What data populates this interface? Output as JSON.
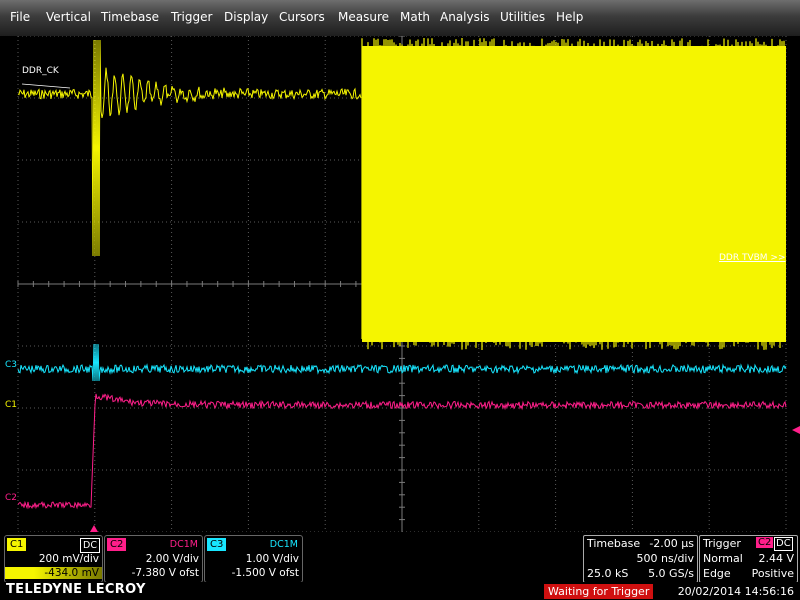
{
  "menu": [
    "File",
    "Vertical",
    "Timebase",
    "Trigger",
    "Display",
    "Cursors",
    "Measure",
    "Math",
    "Analysis",
    "Utilities",
    "Help"
  ],
  "colors": {
    "c1": "#f5f500",
    "c2": "#ff1f8a",
    "c3": "#18e6ff",
    "grid": "#5a5a5a",
    "trigger_marker": "#ff1f8a"
  },
  "grid": {
    "h_divisions": 10,
    "v_divisions": 8
  },
  "traces": {
    "c1": {
      "label": "C1",
      "annotation": "DDR_CK"
    },
    "c2": {
      "label": "C2"
    },
    "c3": {
      "label": "C3"
    },
    "right_annotation": "DDR TVBM >>"
  },
  "channels": [
    {
      "name": "C1",
      "coupling": "DC",
      "scale": "200 mV/div",
      "offset": "-434.0 mV"
    },
    {
      "name": "C2",
      "coupling": "DC1M",
      "scale": "2.00 V/div",
      "offset": "-7.380 V ofst"
    },
    {
      "name": "C3",
      "coupling": "DC1M",
      "scale": "1.00 V/div",
      "offset": "-1.500 V ofst"
    }
  ],
  "timebase": {
    "label": "Timebase",
    "delay": "-2.00 µs",
    "per_div": "500 ns/div",
    "samples": "25.0 kS",
    "rate": "5.0 GS/s"
  },
  "trigger": {
    "label": "Trigger",
    "source": "C2",
    "coupling": "DC",
    "mode": "Normal",
    "level": "2.44 V",
    "type": "Edge",
    "slope": "Positive"
  },
  "brand": "TELEDYNE LECROY",
  "status": "Waiting for Trigger",
  "datetime": "20/02/2014 14:56:16"
}
